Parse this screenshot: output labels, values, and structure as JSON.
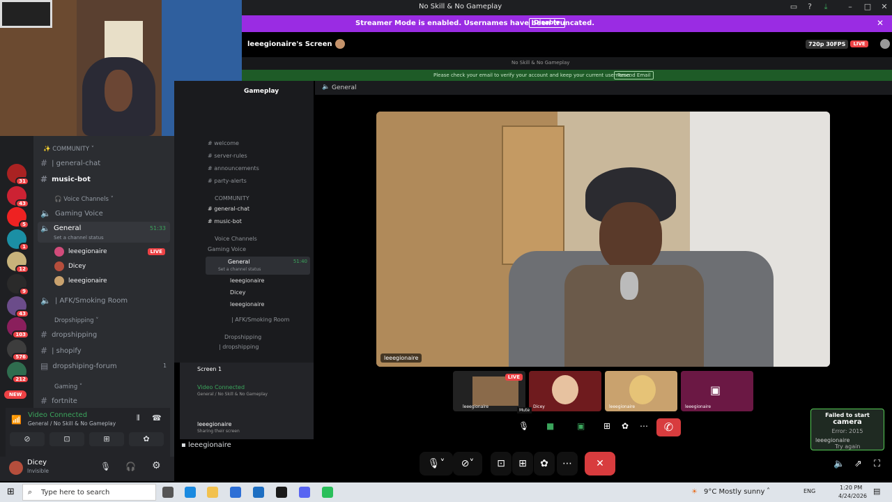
{
  "window": {
    "title": "No Skill & No Gameplay"
  },
  "streamer_banner": {
    "message": "Streamer Mode is enabled. Usernames have been truncated.",
    "disable_label": "Disable"
  },
  "stream": {
    "title": "leeegionaire's Screen",
    "quality": "720p 30FPS",
    "live": "LIVE",
    "inner_title": "No Skill & No Gameplay",
    "verify_msg": "Please check your email to verify your account and keep your current username.",
    "resend": "Resend Email",
    "channel": "General",
    "main_label": "leeegionaire",
    "server_header": "Gameplay",
    "mute_tooltip": "Mute"
  },
  "tiles": [
    {
      "label": "leeegionaire",
      "live": "LIVE"
    },
    {
      "label": "Dicey"
    },
    {
      "label": "leeegionaire"
    },
    {
      "label": "leeegionaire"
    }
  ],
  "inner_sidebar": {
    "items": [
      "welcome",
      "server-rules",
      "announcements",
      "party-alerts"
    ],
    "community": "COMMUNITY",
    "community_items": [
      "general-chat",
      "music-bot"
    ],
    "voice": "Voice Channels",
    "gaming_voice": "Gaming Voice",
    "general": "General",
    "general_time": "51:40",
    "status": "Set a channel status",
    "users": [
      "leeegionaire",
      "Dicey",
      "leeegionaire"
    ],
    "afk": "AFK/Smoking Room",
    "drop_cat": "Dropshipping",
    "drop_item": "dropshipping",
    "screen": "Screen 1",
    "video_connected": "Video Connected",
    "path": "General / No Skill & No Gameplay",
    "user": "leeegionaire",
    "user_status": "Sharing their screen"
  },
  "guild_badges": [
    "31",
    "43",
    "5",
    "1",
    "12",
    "9",
    "43",
    "103",
    "576",
    "212"
  ],
  "new_label": "NEW",
  "channels": {
    "community": "COMMUNITY",
    "general_chat": "| general-chat",
    "music_bot": "music-bot",
    "voice_channels": "Voice Channels",
    "gaming_voice": "Gaming Voice",
    "general": "General",
    "general_time": "51:33",
    "status": "Set a channel status",
    "users": [
      {
        "name": "leeegionaire",
        "live": "LIVE"
      },
      {
        "name": "Dicey"
      },
      {
        "name": "leeegionaire"
      }
    ],
    "afk": "| AFK/Smoking Room",
    "dropshipping_cat": "Dropshipping",
    "dropshipping": "dropshipping",
    "shopify": "| shopify",
    "forum": "dropshiping-forum",
    "forum_count": "1",
    "gaming_cat": "Gaming",
    "fortnite": "fortnite"
  },
  "voice_panel": {
    "status": "Video Connected",
    "path": "General / No Skill & No Gameplay"
  },
  "user_panel": {
    "name": "Dicey",
    "status": "Invisible"
  },
  "bottom_user": "leeegionaire",
  "toast": {
    "title1": "Failed to start",
    "title2": "camera",
    "error": "Error: 2015",
    "user": "leeegionaire",
    "retry": "Try again"
  },
  "taskbar": {
    "search": "Type here to search",
    "weather": "9°C  Mostly sunny",
    "lang": "ENG",
    "time": "1:20 PM",
    "date": "4/24/2026"
  }
}
